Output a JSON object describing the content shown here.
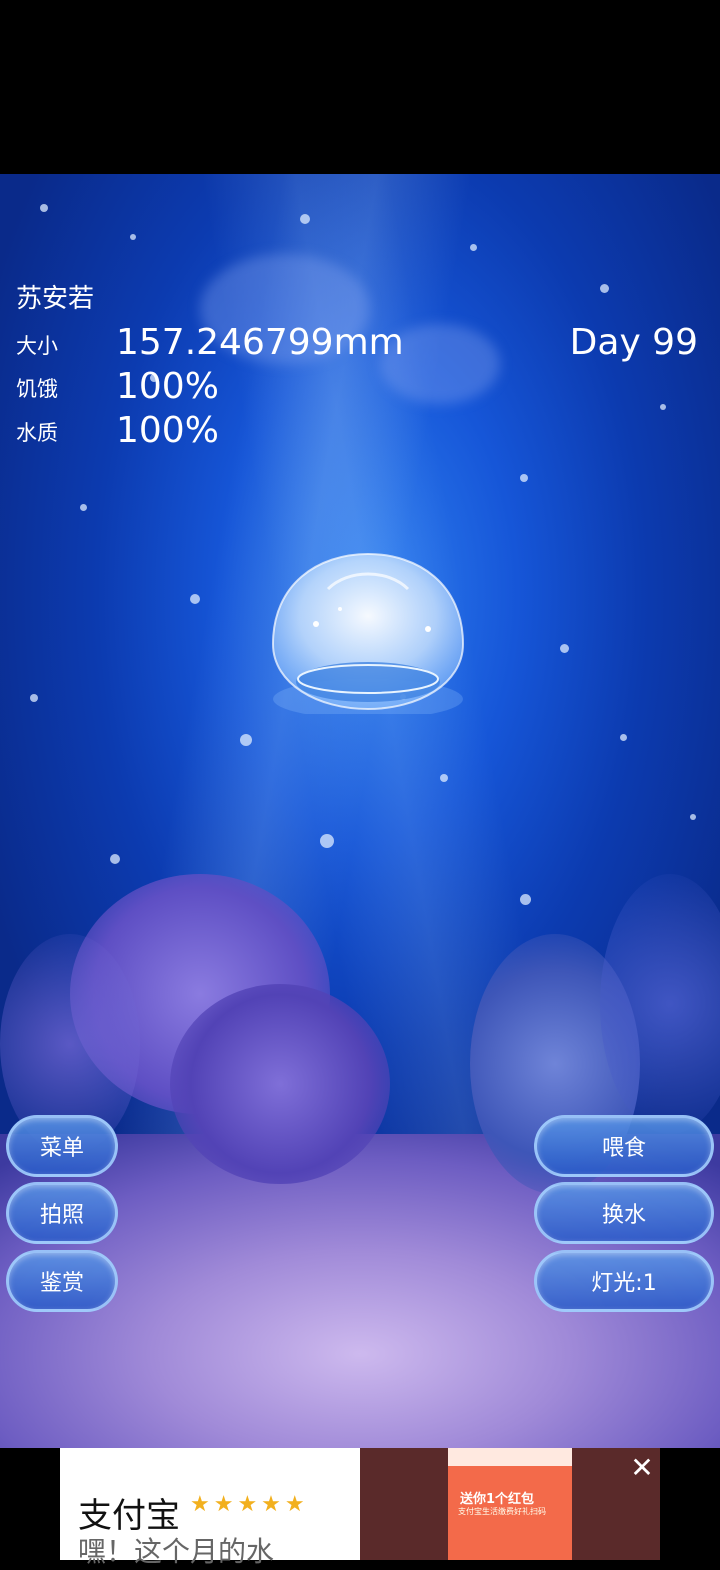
{
  "pet": {
    "name": "苏安若",
    "day": "Day 99",
    "stats": [
      {
        "label": "大小",
        "value": "157.246799mm"
      },
      {
        "label": "饥饿",
        "value": "100%"
      },
      {
        "label": "水质",
        "value": "100%"
      }
    ]
  },
  "buttons": {
    "menu": "菜单",
    "photo": "拍照",
    "appreciate": "鉴赏",
    "feed": "喂食",
    "change_water": "换水",
    "light": "灯光:1"
  },
  "ad": {
    "title": "支付宝",
    "rating_stars": "★★★★★",
    "subtitle": "嘿！这个月的水",
    "promo": "送你1个红包",
    "promo_sub": "支付宝生活缴费好礼扫码",
    "close_icon": "close-icon"
  },
  "colors": {
    "water": "#1656d8",
    "button_border": "#aad2ff",
    "star": "#f2b01e"
  }
}
